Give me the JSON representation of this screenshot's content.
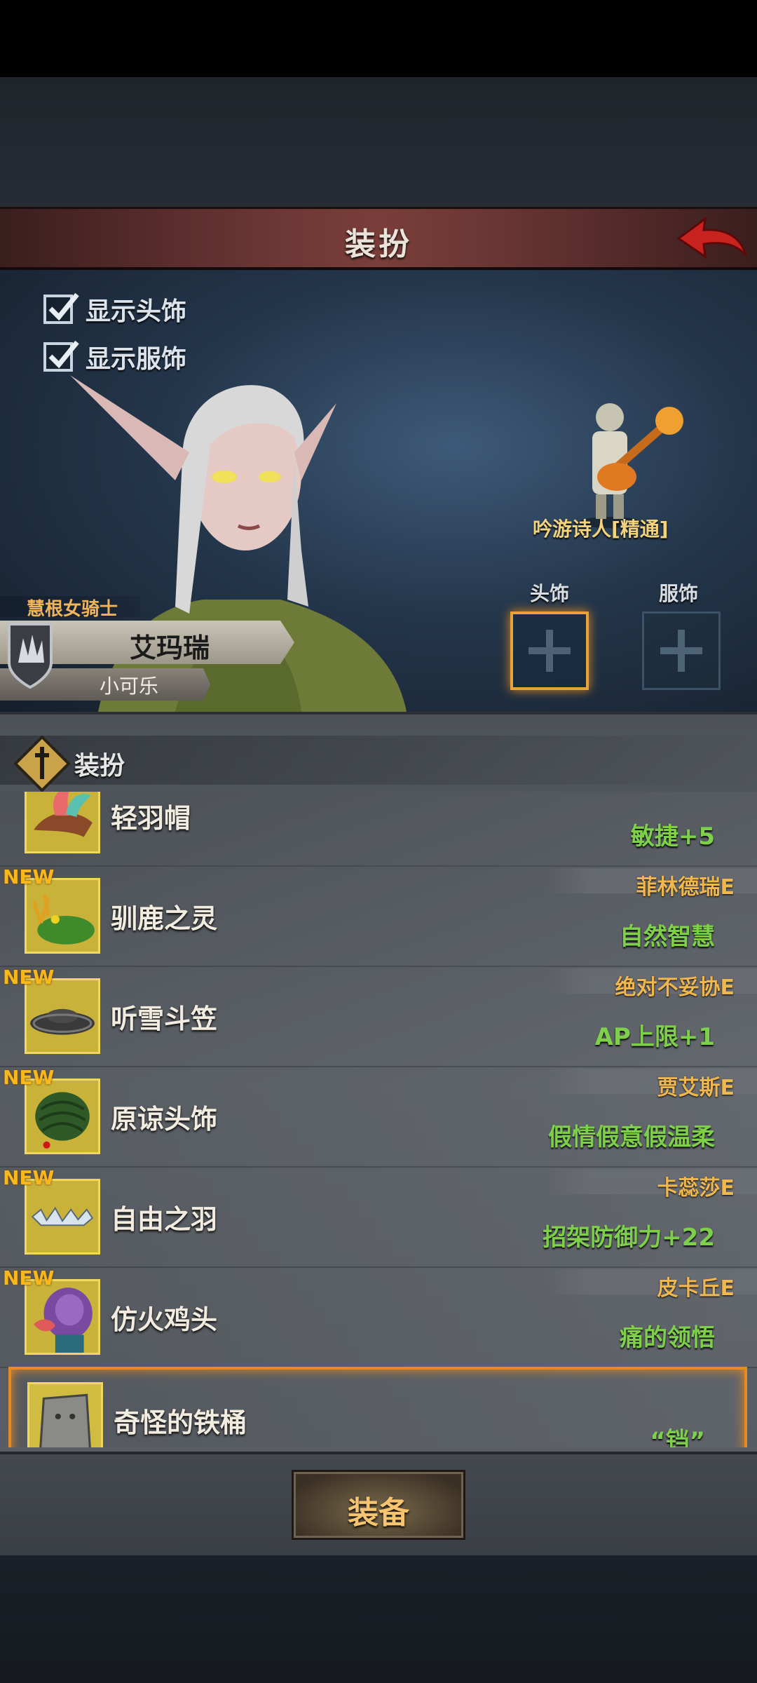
{
  "header": {
    "title": "装扮"
  },
  "options": [
    {
      "label": "显示头饰",
      "checked": true
    },
    {
      "label": "显示服饰",
      "checked": true
    }
  ],
  "character": {
    "class": "慧根女骑士",
    "name": "艾玛瑞",
    "subtitle": "小可乐"
  },
  "bard": {
    "name": "吟游诗人[精通]"
  },
  "slots": [
    {
      "label": "头饰",
      "active": true
    },
    {
      "label": "服饰",
      "active": false
    }
  ],
  "list": {
    "title": "装扮",
    "items": [
      {
        "name": "轻羽帽",
        "owner": "",
        "effect": "敏捷+5",
        "new": false,
        "icon": "feather-hat-icon"
      },
      {
        "name": "驯鹿之灵",
        "owner": "菲林德瑞E",
        "effect": "自然智慧",
        "new": true,
        "badge": "NEW",
        "icon": "reindeer-spirit-icon"
      },
      {
        "name": "听雪斗笠",
        "owner": "绝对不妥协E",
        "effect": "AP上限+1",
        "new": true,
        "badge": "NEW",
        "icon": "straw-hat-icon"
      },
      {
        "name": "原谅头饰",
        "owner": "贾艾斯E",
        "effect": "假情假意假温柔",
        "new": true,
        "badge": "NEW",
        "icon": "green-hat-icon"
      },
      {
        "name": "自由之羽",
        "owner": "卡蕊莎E",
        "effect": "招架防御力+22",
        "new": true,
        "badge": "NEW",
        "icon": "silver-feather-icon"
      },
      {
        "name": "仿火鸡头",
        "owner": "皮卡丘E",
        "effect": "痛的领悟",
        "new": true,
        "badge": "NEW",
        "icon": "turkey-head-icon"
      },
      {
        "name": "奇怪的铁桶",
        "owner": "",
        "effect": "“铛”",
        "new": false,
        "selected": true,
        "icon": "iron-bucket-icon"
      }
    ]
  },
  "footer": {
    "equip_label": "装备"
  }
}
